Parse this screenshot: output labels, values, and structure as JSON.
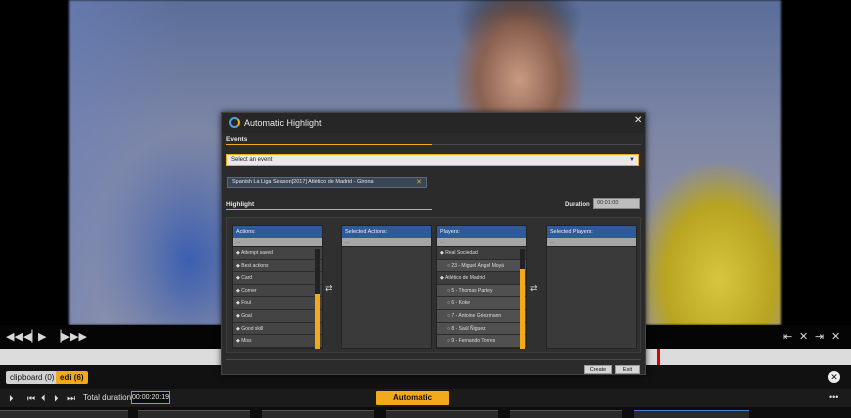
{
  "dialog": {
    "title": "Automatic Highlight",
    "events_label": "Events",
    "event_select_placeholder": "Select an event",
    "selected_event": "Spanish La Liga Season[2017] Atlético de Madrid - Girona",
    "highlight_label": "Highlight",
    "duration_label": "Duration",
    "duration_value": "00:01:00",
    "actions_panel": {
      "header": "Actions:",
      "filter": "...",
      "items": [
        "Attempt saved",
        "Best actions",
        "Card",
        "Corner",
        "Foul",
        "Goal",
        "Good skill",
        "Miss"
      ]
    },
    "selected_actions_panel": {
      "header": "Selected Actions:",
      "filter": "..."
    },
    "players_panel": {
      "header": "Players:",
      "filter": "...",
      "items": [
        {
          "label": "Real Sociedad",
          "type": "group"
        },
        {
          "label": "23 - Miguel Ángel Moyá",
          "type": "player"
        },
        {
          "label": "Atlético de Madrid",
          "type": "group"
        },
        {
          "label": "5 - Thomas Partey",
          "type": "player"
        },
        {
          "label": "6 - Koke",
          "type": "player"
        },
        {
          "label": "7 - Antoine Griezmann",
          "type": "player"
        },
        {
          "label": "8 - Saúl Ñiguez",
          "type": "player"
        },
        {
          "label": "9 - Fernando Torres",
          "type": "player"
        }
      ]
    },
    "selected_players_panel": {
      "header": "Selected Players:",
      "filter": "..."
    },
    "create_label": "Create",
    "exit_label": "Exit"
  },
  "tabs": {
    "clipboard": "clipboard (0)",
    "edi": "edi (6)"
  },
  "bottombar": {
    "total_duration_label": "Total duration:",
    "total_duration_value": "00:00:20:19",
    "automatic_highlight_label": "Automatic Highlight"
  },
  "icons": {
    "bullet": "◆",
    "player_bullet": "○",
    "swap": "⇄"
  },
  "colors": {
    "accent": "#f2a91a",
    "panel_header": "#2e5a9a",
    "timeline_marker": "#dd0000"
  }
}
